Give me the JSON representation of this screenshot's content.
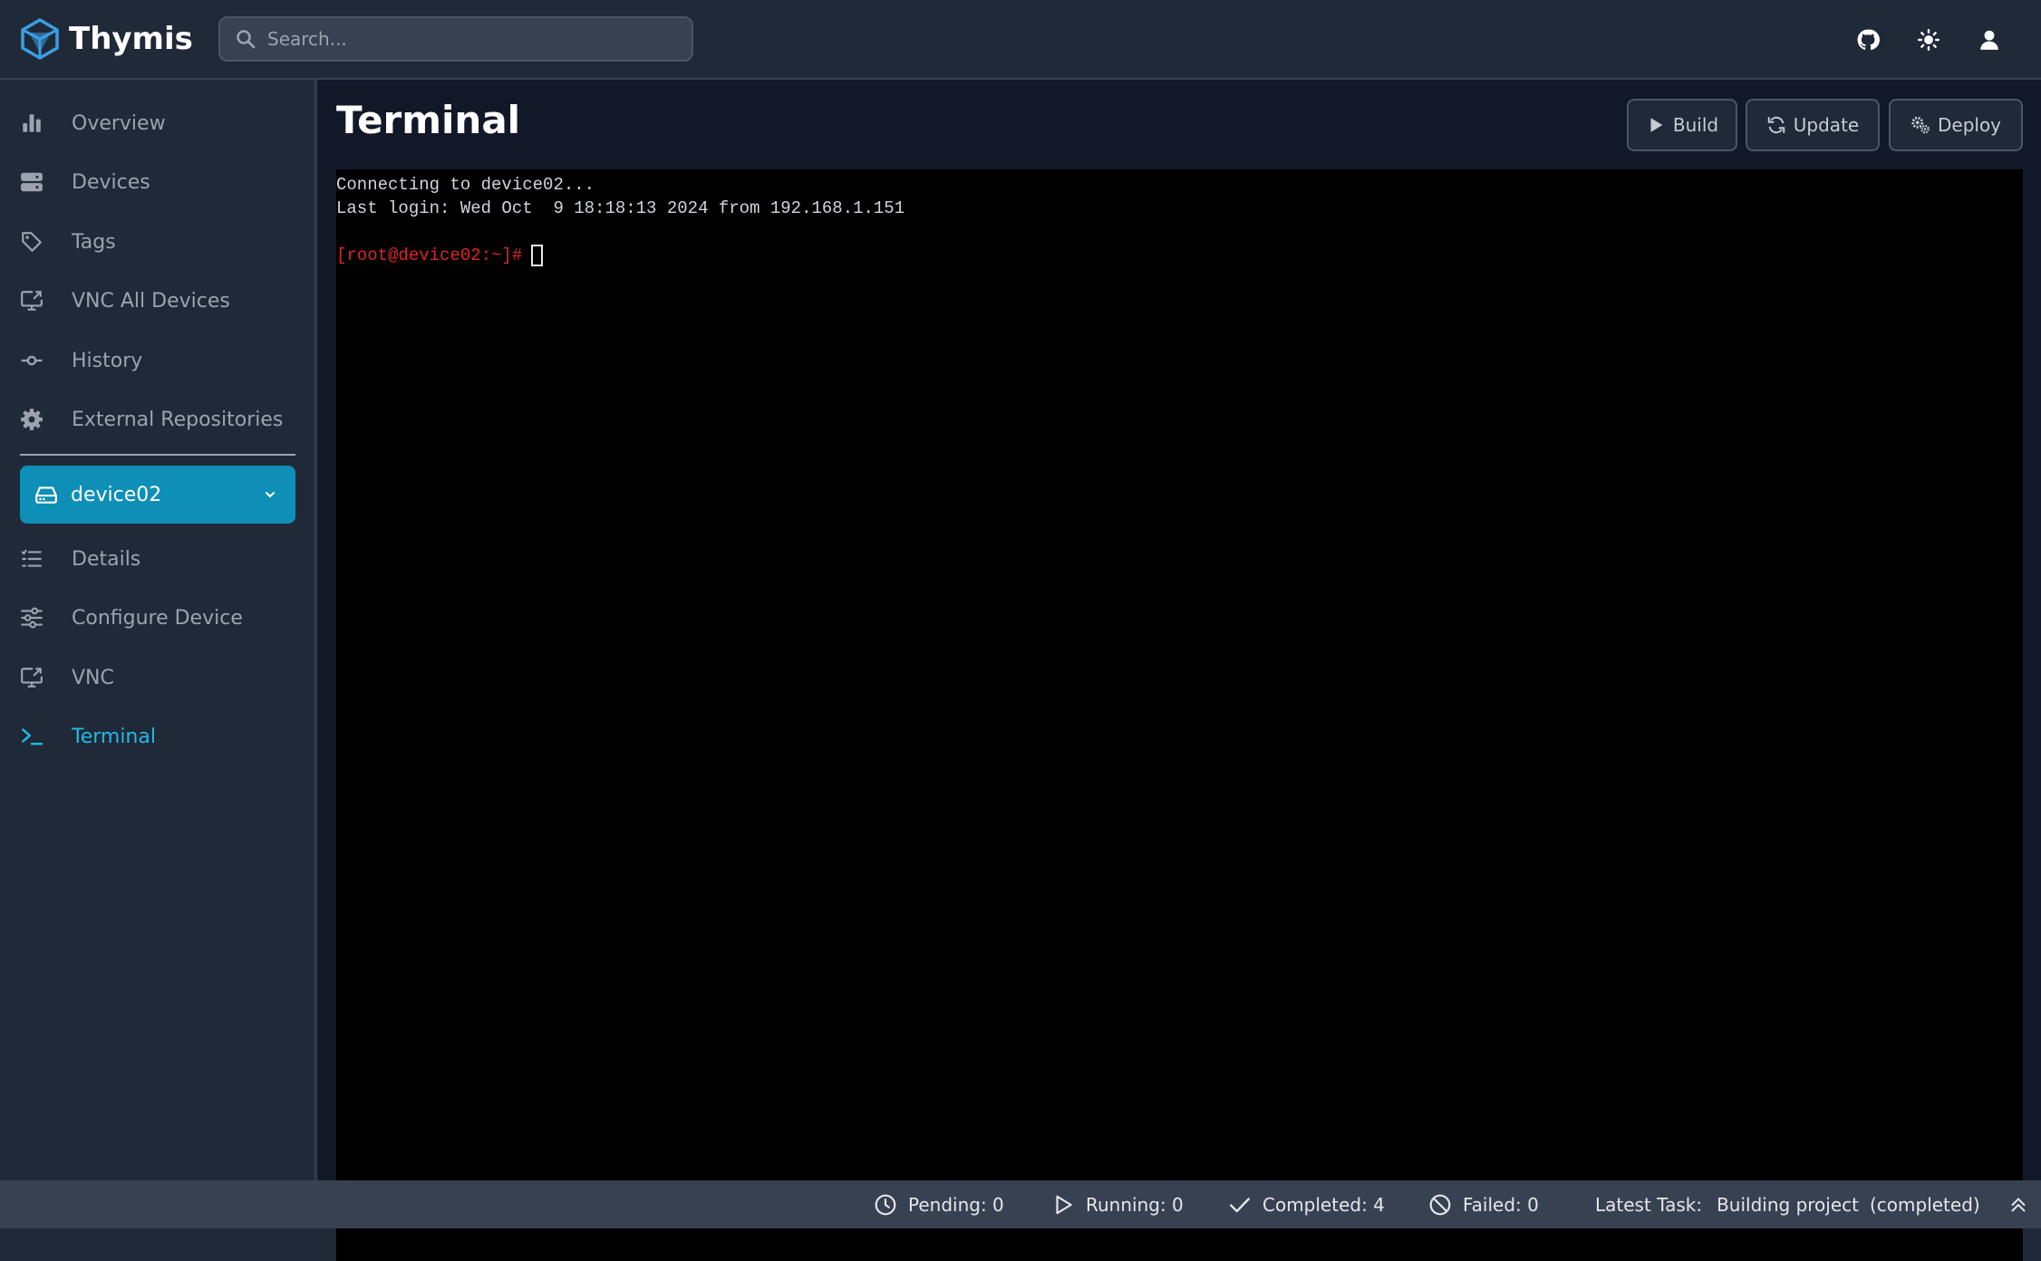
{
  "app": {
    "name": "Thymis",
    "brand_color": "#3b9ee5"
  },
  "search": {
    "placeholder": "Search..."
  },
  "topbar": {
    "icons": [
      "github-icon",
      "theme-toggle-icon",
      "user-icon"
    ]
  },
  "sidebar": {
    "items": [
      {
        "label": "Overview",
        "icon": "bar-chart-icon"
      },
      {
        "label": "Devices",
        "icon": "server-icon"
      },
      {
        "label": "Tags",
        "icon": "tag-icon"
      },
      {
        "label": "VNC All Devices",
        "icon": "monitor-icon"
      },
      {
        "label": "History",
        "icon": "commit-icon"
      },
      {
        "label": "External Repositories",
        "icon": "gear-icon"
      }
    ],
    "device": {
      "name": "device02",
      "icon": "hard-drive-icon"
    },
    "device_items": [
      {
        "label": "Details",
        "icon": "list-icon"
      },
      {
        "label": "Configure Device",
        "icon": "sliders-icon"
      },
      {
        "label": "VNC",
        "icon": "monitor-icon"
      },
      {
        "label": "Terminal",
        "icon": "terminal-icon",
        "active": true
      }
    ],
    "active_color": "#22b8e6",
    "device_bg": "#0e8fb7"
  },
  "main": {
    "title": "Terminal",
    "actions": {
      "build": "Build",
      "update": "Update",
      "deploy": "Deploy"
    }
  },
  "terminal": {
    "lines": [
      "Connecting to device02...",
      "Last login: Wed Oct  9 18:18:13 2024 from 192.168.1.151"
    ],
    "prompt": "[root@device02:~]#",
    "prompt_color": "#dc2626"
  },
  "status": {
    "pending": "Pending: 0",
    "running": "Running: 0",
    "completed": "Completed: 4",
    "failed": "Failed: 0",
    "latest_label": "Latest Task:",
    "latest_value": "Building project",
    "latest_state": "(completed)"
  }
}
